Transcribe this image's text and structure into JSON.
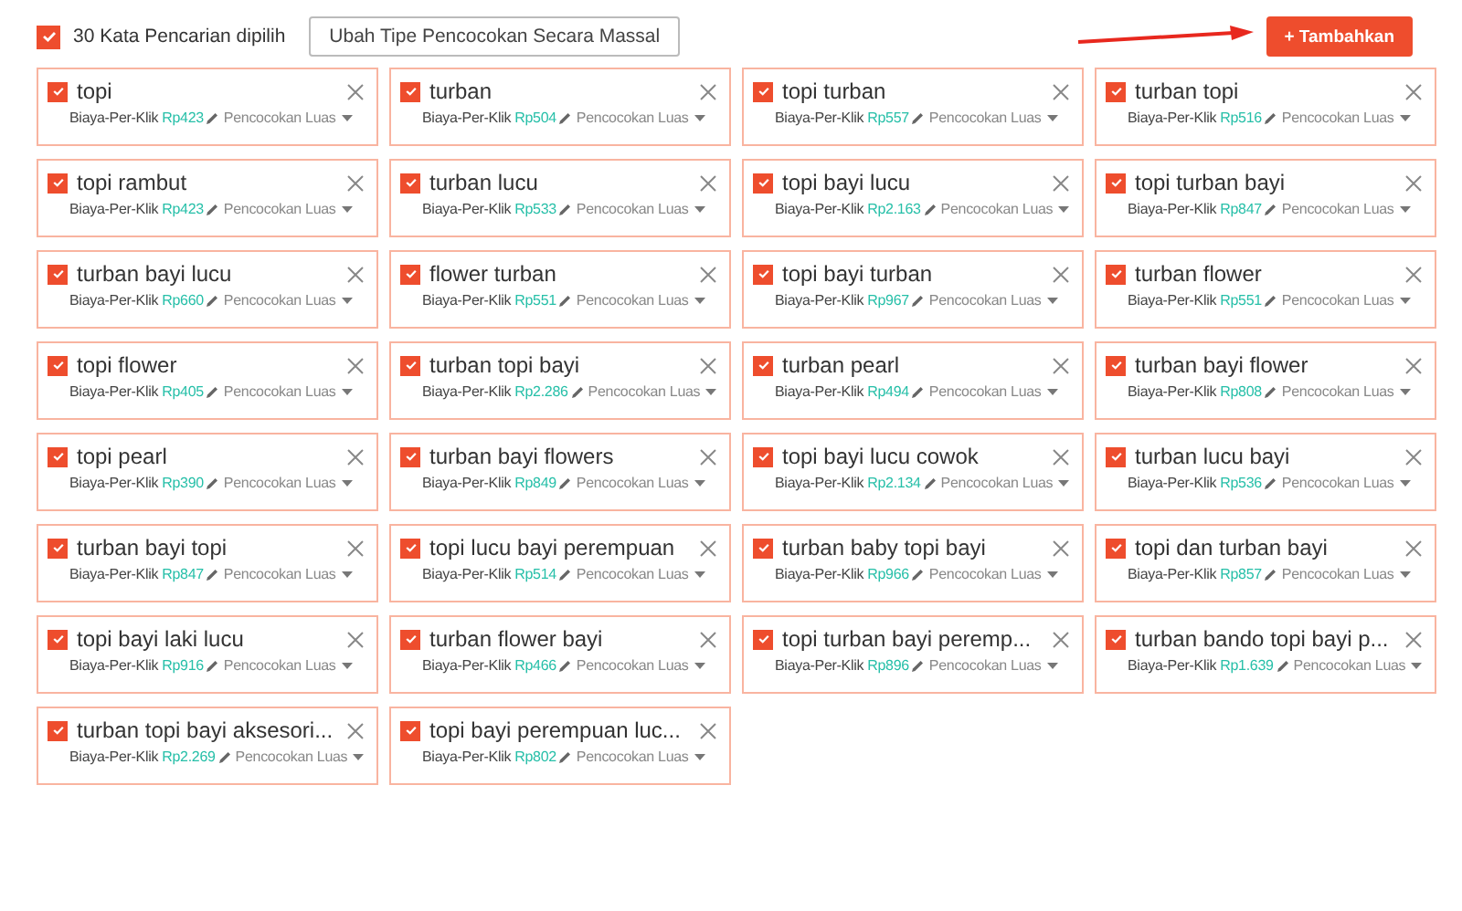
{
  "header": {
    "select_all": {
      "checked": true,
      "label": "30 Kata Pencarian dipilih"
    },
    "bulk_button": "Ubah Tipe Pencocokan Secara Massal",
    "add_button": "+ Tambahkan"
  },
  "keywords": [
    {
      "text": "topi",
      "checked": true,
      "cost_label": "Biaya-Per-Klik",
      "cost": "Rp423",
      "match": "Pencocokan Luas"
    },
    {
      "text": "turban",
      "checked": true,
      "cost_label": "Biaya-Per-Klik",
      "cost": "Rp504",
      "match": "Pencocokan Luas"
    },
    {
      "text": "topi turban",
      "checked": true,
      "cost_label": "Biaya-Per-Klik",
      "cost": "Rp557",
      "match": "Pencocokan Luas"
    },
    {
      "text": "turban topi",
      "checked": true,
      "cost_label": "Biaya-Per-Klik",
      "cost": "Rp516",
      "match": "Pencocokan Luas"
    },
    {
      "text": "topi rambut",
      "checked": true,
      "cost_label": "Biaya-Per-Klik",
      "cost": "Rp423",
      "match": "Pencocokan Luas"
    },
    {
      "text": "turban lucu",
      "checked": true,
      "cost_label": "Biaya-Per-Klik",
      "cost": "Rp533",
      "match": "Pencocokan Luas"
    },
    {
      "text": "topi bayi lucu",
      "checked": true,
      "cost_label": "Biaya-Per-Klik",
      "cost": "Rp2.163",
      "match": "Pencocokan Luas"
    },
    {
      "text": "topi turban bayi",
      "checked": true,
      "cost_label": "Biaya-Per-Klik",
      "cost": "Rp847",
      "match": "Pencocokan Luas"
    },
    {
      "text": "turban bayi lucu",
      "checked": true,
      "cost_label": "Biaya-Per-Klik",
      "cost": "Rp660",
      "match": "Pencocokan Luas"
    },
    {
      "text": "flower turban",
      "checked": true,
      "cost_label": "Biaya-Per-Klik",
      "cost": "Rp551",
      "match": "Pencocokan Luas"
    },
    {
      "text": "topi bayi turban",
      "checked": true,
      "cost_label": "Biaya-Per-Klik",
      "cost": "Rp967",
      "match": "Pencocokan Luas"
    },
    {
      "text": "turban flower",
      "checked": true,
      "cost_label": "Biaya-Per-Klik",
      "cost": "Rp551",
      "match": "Pencocokan Luas"
    },
    {
      "text": "topi flower",
      "checked": true,
      "cost_label": "Biaya-Per-Klik",
      "cost": "Rp405",
      "match": "Pencocokan Luas"
    },
    {
      "text": "turban topi bayi",
      "checked": true,
      "cost_label": "Biaya-Per-Klik",
      "cost": "Rp2.286",
      "match": "Pencocokan Luas"
    },
    {
      "text": "turban pearl",
      "checked": true,
      "cost_label": "Biaya-Per-Klik",
      "cost": "Rp494",
      "match": "Pencocokan Luas"
    },
    {
      "text": "turban bayi flower",
      "checked": true,
      "cost_label": "Biaya-Per-Klik",
      "cost": "Rp808",
      "match": "Pencocokan Luas"
    },
    {
      "text": "topi pearl",
      "checked": true,
      "cost_label": "Biaya-Per-Klik",
      "cost": "Rp390",
      "match": "Pencocokan Luas"
    },
    {
      "text": "turban bayi flowers",
      "checked": true,
      "cost_label": "Biaya-Per-Klik",
      "cost": "Rp849",
      "match": "Pencocokan Luas"
    },
    {
      "text": "topi bayi lucu cowok",
      "checked": true,
      "cost_label": "Biaya-Per-Klik",
      "cost": "Rp2.134",
      "match": "Pencocokan Luas"
    },
    {
      "text": "turban lucu bayi",
      "checked": true,
      "cost_label": "Biaya-Per-Klik",
      "cost": "Rp536",
      "match": "Pencocokan Luas"
    },
    {
      "text": "turban bayi topi",
      "checked": true,
      "cost_label": "Biaya-Per-Klik",
      "cost": "Rp847",
      "match": "Pencocokan Luas"
    },
    {
      "text": "topi lucu bayi perempuan",
      "checked": true,
      "cost_label": "Biaya-Per-Klik",
      "cost": "Rp514",
      "match": "Pencocokan Luas"
    },
    {
      "text": "turban baby topi bayi",
      "checked": true,
      "cost_label": "Biaya-Per-Klik",
      "cost": "Rp966",
      "match": "Pencocokan Luas"
    },
    {
      "text": "topi dan turban bayi",
      "checked": true,
      "cost_label": "Biaya-Per-Klik",
      "cost": "Rp857",
      "match": "Pencocokan Luas"
    },
    {
      "text": "topi bayi laki lucu",
      "checked": true,
      "cost_label": "Biaya-Per-Klik",
      "cost": "Rp916",
      "match": "Pencocokan Luas"
    },
    {
      "text": "turban flower bayi",
      "checked": true,
      "cost_label": "Biaya-Per-Klik",
      "cost": "Rp466",
      "match": "Pencocokan Luas"
    },
    {
      "text": "topi turban bayi peremp...",
      "checked": true,
      "cost_label": "Biaya-Per-Klik",
      "cost": "Rp896",
      "match": "Pencocokan Luas"
    },
    {
      "text": "turban bando topi bayi p...",
      "checked": true,
      "cost_label": "Biaya-Per-Klik",
      "cost": "Rp1.639",
      "match": "Pencocokan Luas"
    },
    {
      "text": "turban topi bayi aksesori...",
      "checked": true,
      "cost_label": "Biaya-Per-Klik",
      "cost": "Rp2.269",
      "match": "Pencocokan Luas"
    },
    {
      "text": "topi bayi perempuan luc...",
      "checked": true,
      "cost_label": "Biaya-Per-Klik",
      "cost": "Rp802",
      "match": "Pencocokan Luas"
    }
  ]
}
